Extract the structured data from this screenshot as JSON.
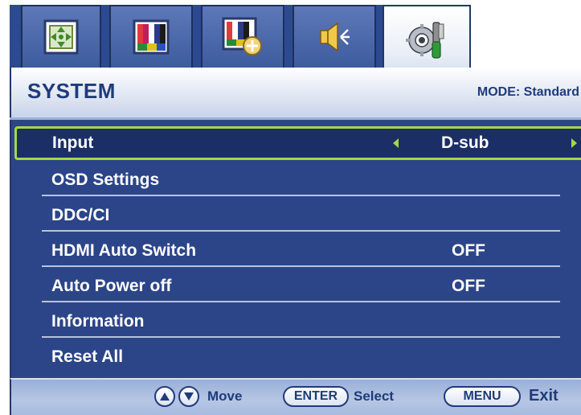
{
  "tabs": [
    {
      "icon": "picture-adjust-icon",
      "active": false
    },
    {
      "icon": "color-bars-icon",
      "active": false
    },
    {
      "icon": "picture-advanced-icon",
      "active": false
    },
    {
      "icon": "audio-speaker-icon",
      "active": false
    },
    {
      "icon": "system-gear-tools-icon",
      "active": true
    }
  ],
  "header": {
    "title": "SYSTEM",
    "mode": "MODE: Standard"
  },
  "menu": {
    "items": [
      {
        "label": "Input",
        "value": "D-sub",
        "selected": true
      },
      {
        "label": "OSD Settings",
        "value": ""
      },
      {
        "label": "DDC/CI",
        "value": ""
      },
      {
        "label": "HDMI Auto Switch",
        "value": "OFF"
      },
      {
        "label": "Auto Power off",
        "value": "OFF"
      },
      {
        "label": "Information",
        "value": ""
      },
      {
        "label": "Reset All",
        "value": ""
      }
    ]
  },
  "footer": {
    "move": "Move",
    "enter_key": "ENTER",
    "select": "Select",
    "menu_key": "MENU",
    "exit": "Exit"
  },
  "colors": {
    "panel": "#2c4588",
    "accent_text": "#1f3b7a",
    "selection_border": "#a8d44a"
  }
}
